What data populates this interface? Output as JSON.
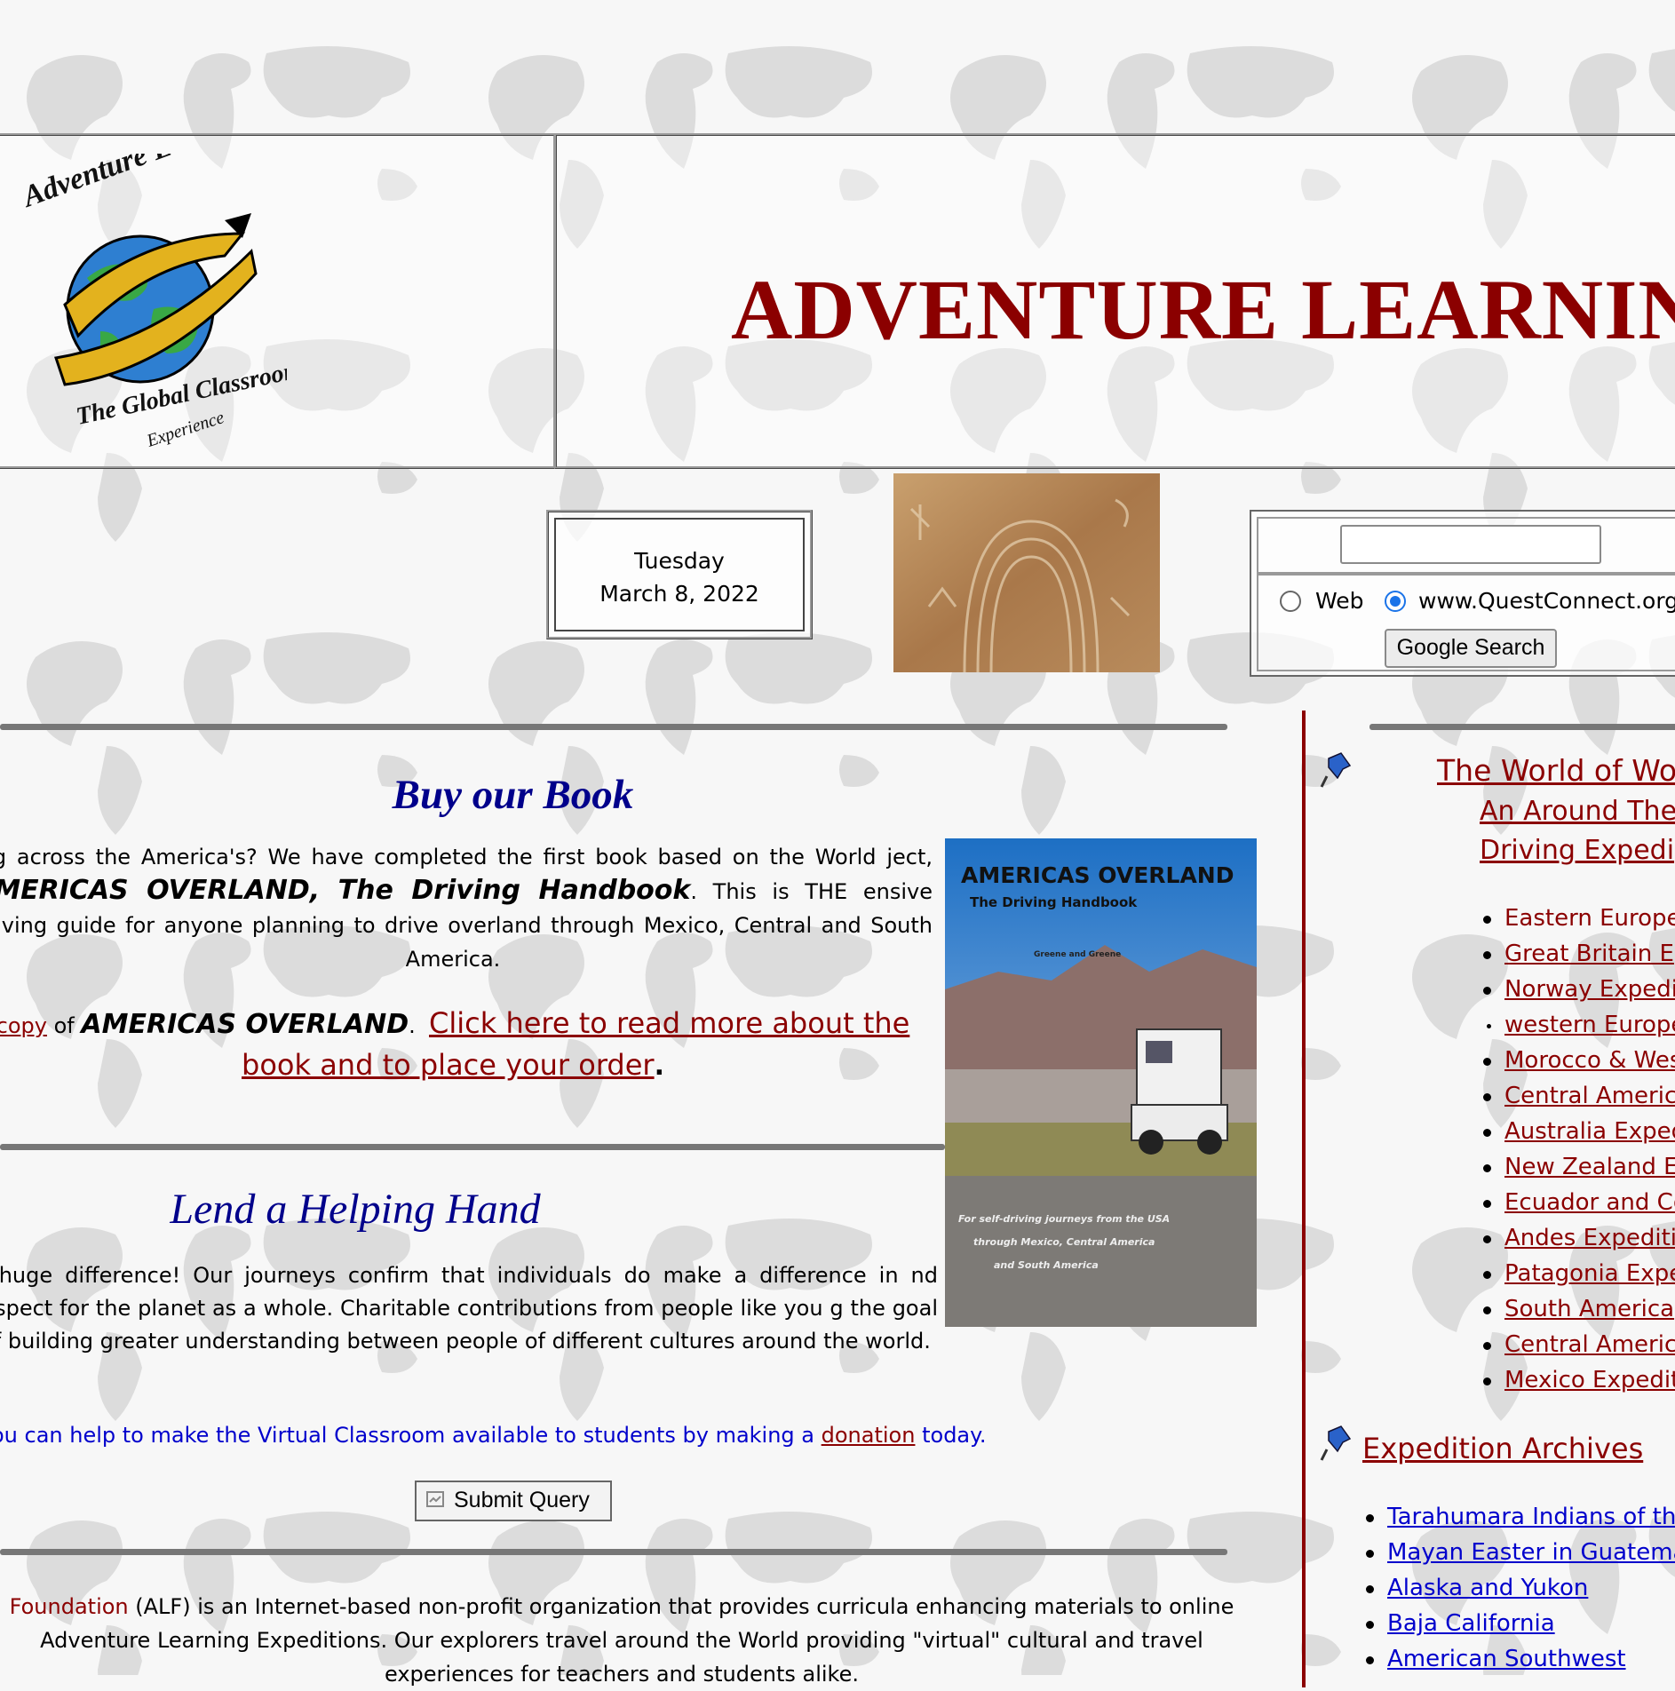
{
  "header": {
    "logo_alt": "Adventure Learning Foundation - The Global Classroom Experience",
    "logo_text_top": "Adventure Learning Foundation",
    "logo_text_bottom": "The Global Classroom",
    "logo_text_small": "Experience",
    "site_title": "ADVENTURE LEARNIN"
  },
  "date": {
    "weekday": "Tuesday",
    "full": "March 8, 2022"
  },
  "search": {
    "query": "",
    "options": [
      {
        "label": "Web",
        "selected": false
      },
      {
        "label": "www.QuestConnect.org",
        "selected": true
      }
    ],
    "button": "Google Search"
  },
  "book": {
    "heading": "Buy our Book",
    "p1_a": "ing across the America's? We have completed the first book based on the World",
    "p1_b": "ject,",
    "p1_title": "AMERICAS OVERLAND, The Driving Handbook",
    "p1_c": ". This is THE",
    "p1_d": "ensive driving guide for anyone planning to drive overland through Mexico, Central and South America.",
    "copy_link": "copy",
    "of": "of",
    "title2": "AMERICAS OVERLAND",
    "dot": ".",
    "order_link": "Click here to read more about the book and to place your order",
    "end": ".",
    "cover_title": "AMERICAS OVERLAND",
    "cover_sub": "The Driving Handbook",
    "cover_authors": "Greene and Greene",
    "cover_tag1": "For self-driving journeys from the USA",
    "cover_tag2": "through Mexico, Central America",
    "cover_tag3": "and South America"
  },
  "lend": {
    "heading": "Lend a Helping Hand",
    "paragraph": "a huge difference! Our journeys confirm that individuals do make a difference in nd respect for the planet as a whole. Charitable contributions from people like you g the goal of building greater understanding between people of different cultures around the world.",
    "help_a": "ou can help to make the Virtual Classroom available to students by making a",
    "donation_link": "donation",
    "help_b": "today.",
    "submit": "Submit Query"
  },
  "about": {
    "alf_link": "Foundation",
    "text": "(ALF) is an Internet-based non-profit organization that provides curricula enhancing materials to online Adventure Learning Expeditions.  Our explorers travel around the World providing \"virtual\" cultural and travel experiences for teachers and students alike."
  },
  "sidebar": {
    "world_heading": "The World of Wo",
    "world_sub1": "An Around The",
    "world_sub2": "Driving Expedi",
    "expeditions": [
      "Eastern Europe",
      "Great Britain E",
      "Norway Expedi",
      "western Europe",
      "Morocco & Wes",
      "Central Americ",
      "Australia Exped",
      "New Zealand E",
      "Ecuador and Co",
      "Andes Expediti",
      "Patagonia Expe",
      "South America",
      "Central Americ",
      "Mexico Expedit"
    ],
    "archives_heading": "Expedition Archives",
    "archives": [
      "Tarahumara Indians of th",
      "Mayan Easter in Guatema",
      "Alaska and Yukon",
      "Baja California",
      "American Southwest"
    ]
  }
}
